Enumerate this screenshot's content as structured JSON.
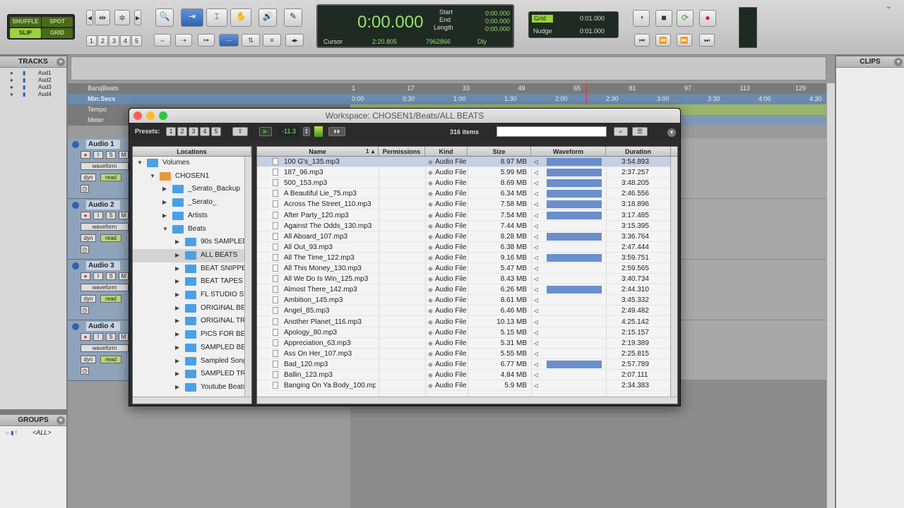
{
  "toolbar": {
    "modes": [
      "SHUFFLE",
      "SPOT",
      "SLIP",
      "GRID"
    ],
    "zoom_presets": [
      "1",
      "2",
      "3",
      "4",
      "5"
    ],
    "counter": {
      "main": "0:00.000",
      "start_label": "Start",
      "end_label": "End",
      "length_label": "Length",
      "start": "0:00.000",
      "end": "0:00.000",
      "length": "0:00.000",
      "cursor_label": "Cursor",
      "cursor": "2:20.805",
      "samples": "7962866",
      "dly": "Dly"
    },
    "grid_label": "Grid",
    "grid_value": "0:01.000",
    "nudge_label": "Nudge",
    "nudge_value": "0:01.000"
  },
  "tracks_panel": {
    "title": "TRACKS",
    "items": [
      "Aud1",
      "Aud2",
      "Aud3",
      "Aud4"
    ]
  },
  "groups_panel": {
    "title": "GROUPS",
    "item": "<ALL>"
  },
  "clips_panel": {
    "title": "CLIPS"
  },
  "edit": {
    "bars_label": "Bars|Beats",
    "min_label": "Min:Secs",
    "tempo_label": "Tempo",
    "meter_label": "Meter",
    "bars_ticks": [
      "1",
      "17",
      "33",
      "49",
      "65",
      "81",
      "97",
      "113",
      "129"
    ],
    "min_ticks": [
      "0:00",
      "0:30",
      "1:00",
      "1:30",
      "2:00",
      "2:30",
      "3:00",
      "3:30",
      "4:00",
      "4:30"
    ],
    "tracks": [
      {
        "name": "Audio 1",
        "view": "waveform",
        "dyn": "dyn",
        "auto": "read"
      },
      {
        "name": "Audio 2",
        "view": "waveform",
        "dyn": "dyn",
        "auto": "read"
      },
      {
        "name": "Audio 3",
        "view": "waveform",
        "dyn": "dyn",
        "auto": "read"
      },
      {
        "name": "Audio 4",
        "view": "waveform",
        "dyn": "dyn",
        "auto": "read"
      }
    ]
  },
  "workspace": {
    "title": "Workspace: CHOSEN1/Beats/ALL BEATS",
    "presets_label": "Presets:",
    "presets": [
      "1",
      "2",
      "3",
      "4",
      "5"
    ],
    "level": "-11.3",
    "items_count": "316 items",
    "search_placeholder": "",
    "locations_header": "Locations",
    "locations": [
      {
        "name": "Volumes",
        "level": 0,
        "open": true,
        "type": "folder"
      },
      {
        "name": "CHOSEN1",
        "level": 1,
        "open": true,
        "type": "drive"
      },
      {
        "name": "_Serato_Backup",
        "level": 2,
        "open": false,
        "type": "folder"
      },
      {
        "name": "_Serato_",
        "level": 2,
        "open": false,
        "type": "folder"
      },
      {
        "name": "Artists",
        "level": 2,
        "open": false,
        "type": "folder"
      },
      {
        "name": "Beats",
        "level": 2,
        "open": true,
        "type": "folder"
      },
      {
        "name": "90s SAMPLED",
        "level": 3,
        "open": false,
        "type": "folder"
      },
      {
        "name": "ALL BEATS",
        "level": 3,
        "open": false,
        "type": "folder",
        "selected": true
      },
      {
        "name": "BEAT SNIPPETS",
        "level": 3,
        "open": false,
        "type": "folder"
      },
      {
        "name": "BEAT TAPES",
        "level": 3,
        "open": false,
        "type": "folder"
      },
      {
        "name": "FL STUDIO ST",
        "level": 3,
        "open": false,
        "type": "folder"
      },
      {
        "name": "ORIGINAL BEATS",
        "level": 3,
        "open": false,
        "type": "folder"
      },
      {
        "name": "ORIGINAL TRACKS",
        "level": 3,
        "open": false,
        "type": "folder"
      },
      {
        "name": "PICS FOR BEATS",
        "level": 3,
        "open": false,
        "type": "folder"
      },
      {
        "name": "SAMPLED BEATS",
        "level": 3,
        "open": false,
        "type": "folder"
      },
      {
        "name": "Sampled Songs",
        "level": 3,
        "open": false,
        "type": "folder"
      },
      {
        "name": "SAMPLED TRACKS",
        "level": 3,
        "open": false,
        "type": "folder"
      },
      {
        "name": "Youtube Beats",
        "level": 3,
        "open": false,
        "type": "folder"
      }
    ],
    "columns": {
      "name": "Name",
      "sort": "1",
      "permissions": "Permissions",
      "kind": "Kind",
      "size": "Size",
      "waveform": "Waveform",
      "duration": "Duration"
    },
    "files": [
      {
        "name": "100 G's_135.mp3",
        "kind": "Audio File",
        "size": "8.97 MB",
        "duration": "3:54.893",
        "wave": true,
        "selected": true
      },
      {
        "name": "187_96.mp3",
        "kind": "Audio File",
        "size": "5.99 MB",
        "duration": "2:37.257",
        "wave": true
      },
      {
        "name": "500_153.mp3",
        "kind": "Audio File",
        "size": "8.69 MB",
        "duration": "3:48.205",
        "wave": true
      },
      {
        "name": "A Beautiful Lie_75.mp3",
        "kind": "Audio File",
        "size": "6.34 MB",
        "duration": "2:46.556",
        "wave": true
      },
      {
        "name": "Across The Street_110.mp3",
        "kind": "Audio File",
        "size": "7.58 MB",
        "duration": "3:18.896",
        "wave": true
      },
      {
        "name": "After Party_120.mp3",
        "kind": "Audio File",
        "size": "7.54 MB",
        "duration": "3:17.485",
        "wave": true
      },
      {
        "name": "Against The Odds_130.mp3",
        "kind": "Audio File",
        "size": "7.44 MB",
        "duration": "3:15.395",
        "wave": false
      },
      {
        "name": "All Aboard_107.mp3",
        "kind": "Audio File",
        "size": "8.28 MB",
        "duration": "3:36.764",
        "wave": true
      },
      {
        "name": "All Out_93.mp3",
        "kind": "Audio File",
        "size": "6.38 MB",
        "duration": "2:47.444",
        "wave": false
      },
      {
        "name": "All The Time_122.mp3",
        "kind": "Audio File",
        "size": "9.16 MB",
        "duration": "3:59.751",
        "wave": true
      },
      {
        "name": "All This Money_130.mp3",
        "kind": "Audio File",
        "size": "5.47 MB",
        "duration": "2:59.565",
        "wave": false
      },
      {
        "name": "All We Do Is Win_125.mp3",
        "kind": "Audio File",
        "size": "8.43 MB",
        "duration": "3:40.734",
        "wave": false
      },
      {
        "name": "Almost There_142.mp3",
        "kind": "Audio File",
        "size": "6.26 MB",
        "duration": "2:44.310",
        "wave": true
      },
      {
        "name": "Ambition_145.mp3",
        "kind": "Audio File",
        "size": "8.61 MB",
        "duration": "3:45.332",
        "wave": false
      },
      {
        "name": "Angel_85.mp3",
        "kind": "Audio File",
        "size": "6.46 MB",
        "duration": "2:49.482",
        "wave": false
      },
      {
        "name": "Another Planet_116.mp3",
        "kind": "Audio File",
        "size": "10.13 MB",
        "duration": "4:25.142",
        "wave": false
      },
      {
        "name": "Apology_80.mp3",
        "kind": "Audio File",
        "size": "5.15 MB",
        "duration": "2:15.157",
        "wave": false
      },
      {
        "name": "Appreciation_63.mp3",
        "kind": "Audio File",
        "size": "5.31 MB",
        "duration": "2:19.389",
        "wave": false
      },
      {
        "name": "Ass On Her_107.mp3",
        "kind": "Audio File",
        "size": "5.55 MB",
        "duration": "2:25.815",
        "wave": false
      },
      {
        "name": "Bad_120.mp3",
        "kind": "Audio File",
        "size": "6.77 MB",
        "duration": "2:57.789",
        "wave": true
      },
      {
        "name": "Ballin_123.mp3",
        "kind": "Audio File",
        "size": "4.84 MB",
        "duration": "2:07.111",
        "wave": false
      },
      {
        "name": "Banging On Ya Body_100.mp3",
        "kind": "Audio File",
        "size": "5.9 MB",
        "duration": "2:34.383",
        "wave": false
      }
    ]
  },
  "colors": {
    "accent": "#9ad23c",
    "select": "#2f62ad",
    "wave": "#6b8fcc",
    "track_blue": "#8fa3ba"
  }
}
